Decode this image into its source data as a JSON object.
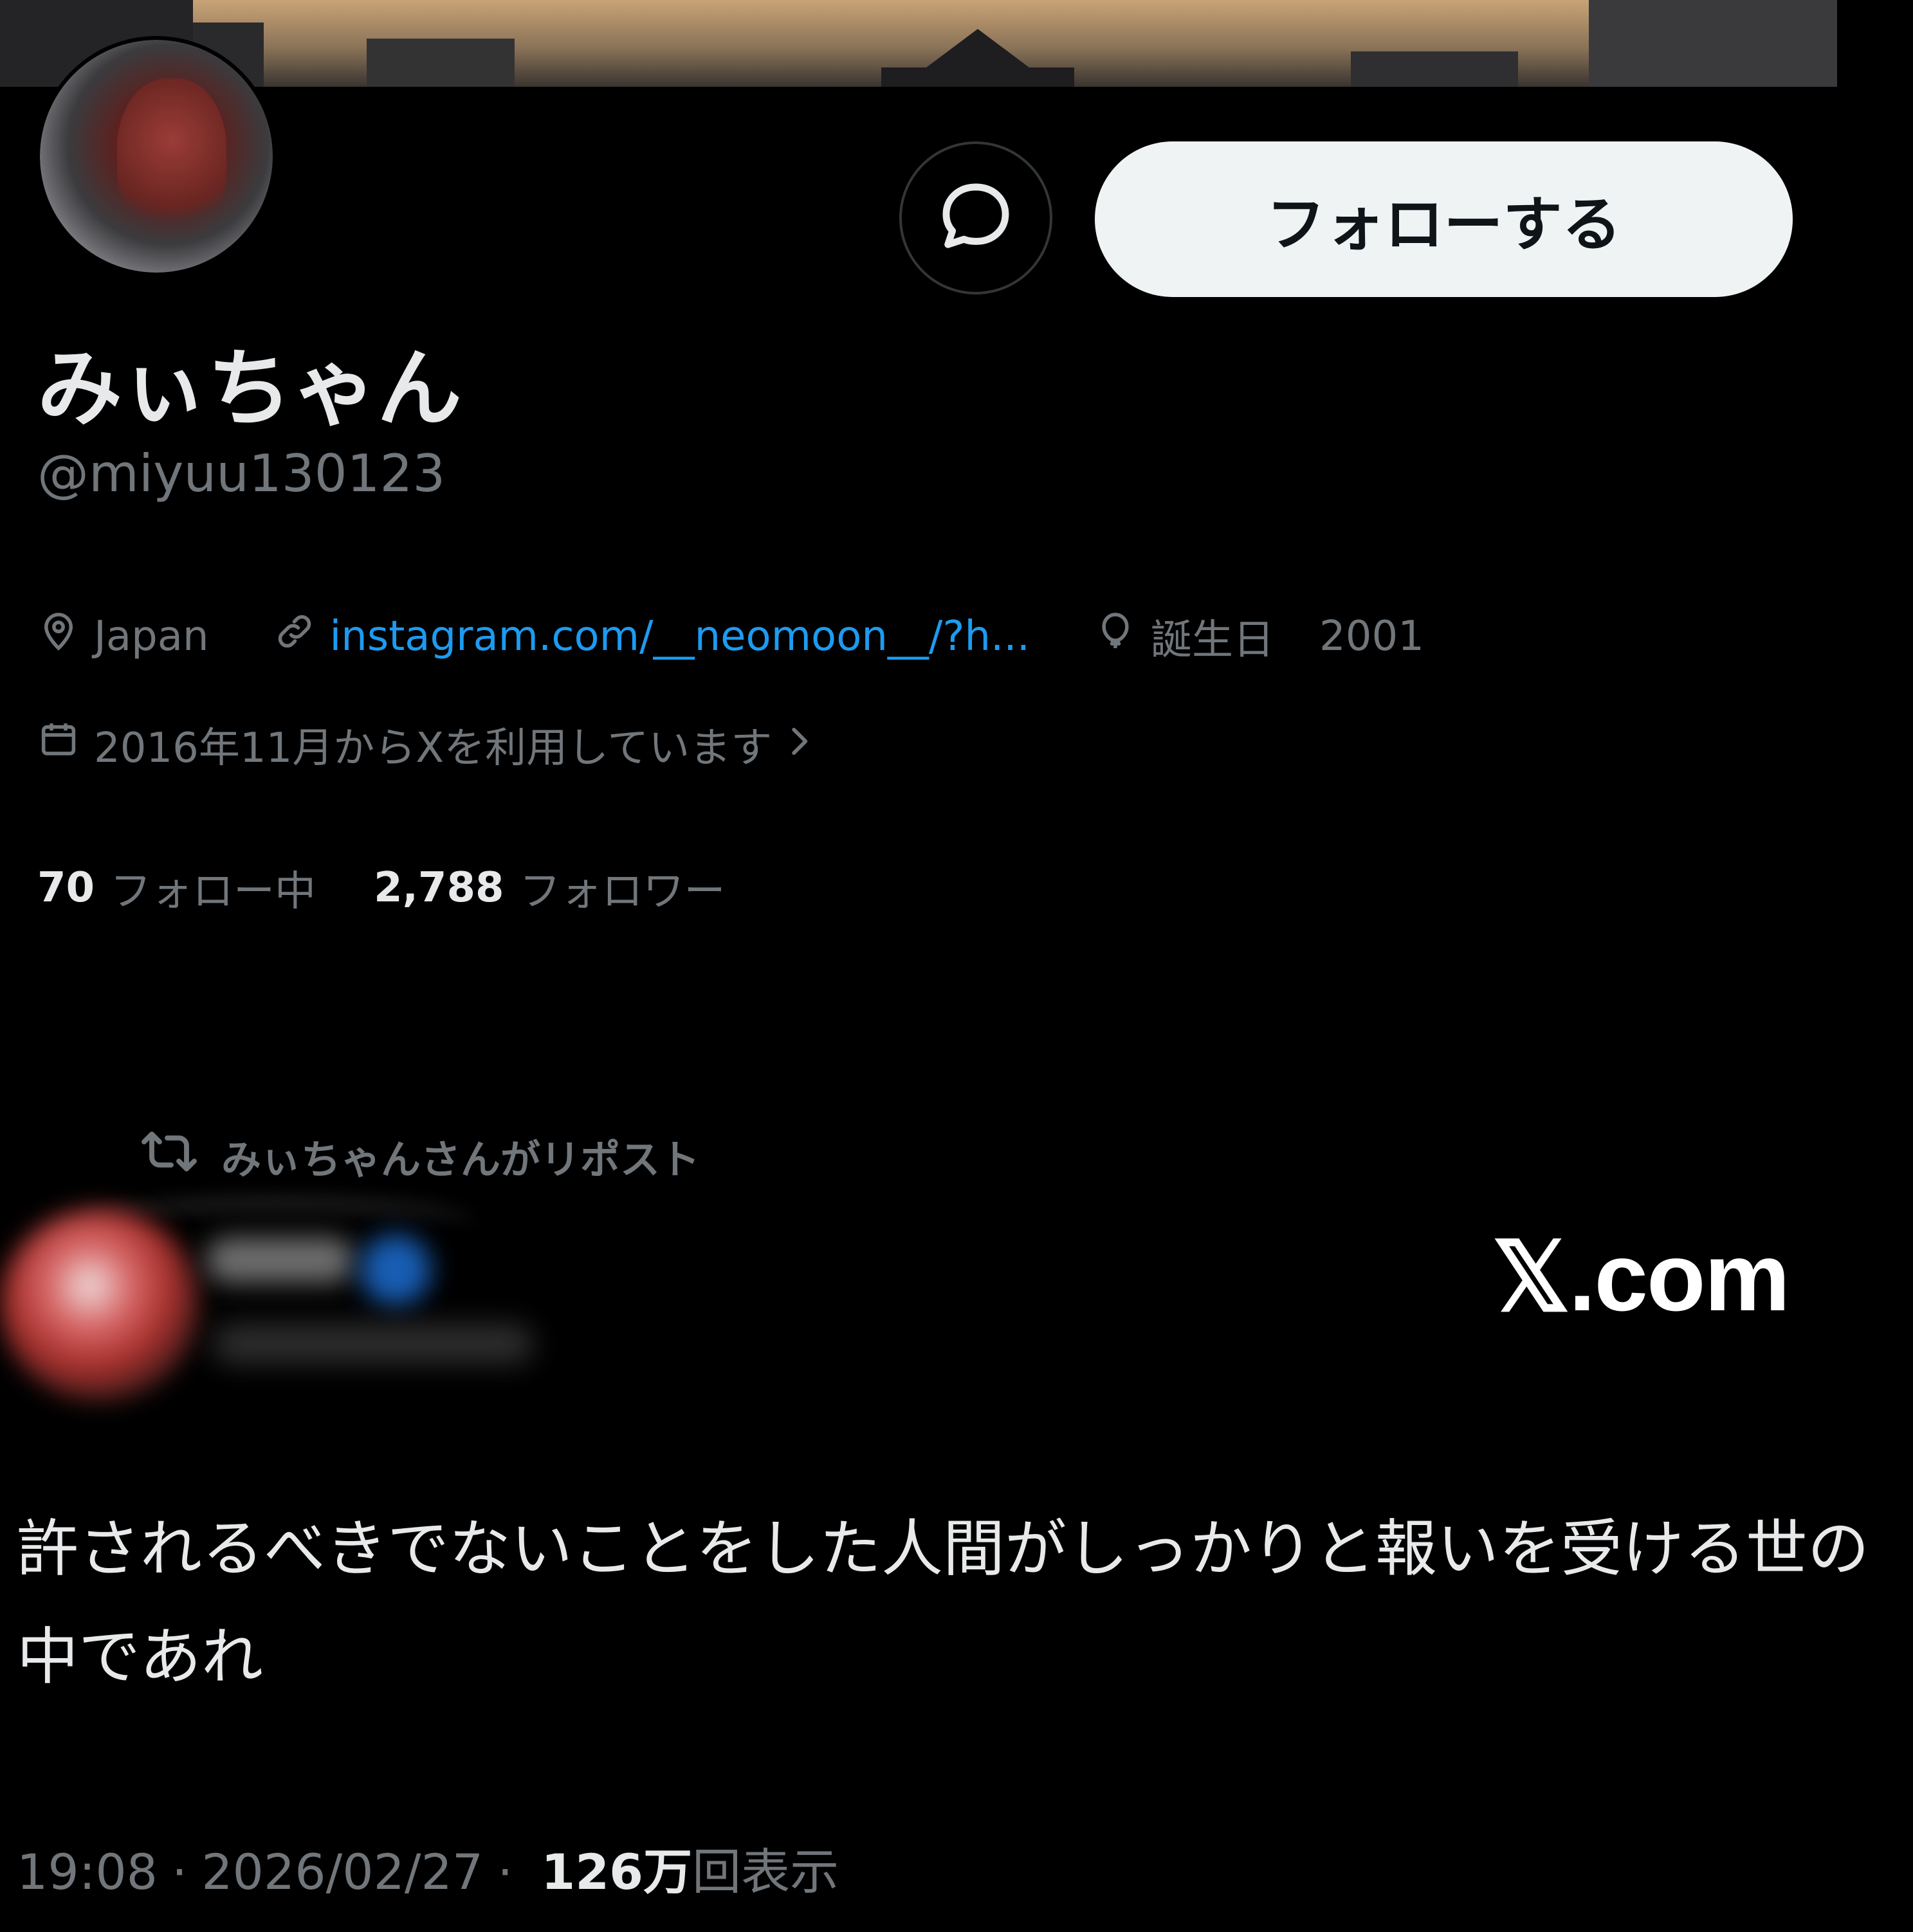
{
  "profile": {
    "display_name": "みぃちゃん",
    "handle": "@miyuu130123",
    "location": "Japan",
    "link": "instagram.com/__neomoon__/?h...",
    "birthday_label": "誕生日",
    "birthday_value": "2001",
    "joined": "2016年11月からXを利用しています"
  },
  "actions": {
    "follow_label": "フォローする"
  },
  "stats": {
    "following_count": "70",
    "following_label": "フォロー中",
    "followers_count": "2,788",
    "followers_label": "フォロワー"
  },
  "post": {
    "repost_label": "みぃちゃんさんがリポスト",
    "text": "許されるべきでないことをした人間がしっかりと報いを受ける世の中であれ",
    "time": "19:08",
    "date": "2026/02/27",
    "separator": "·",
    "views_count": "126万",
    "views_label": "回表示"
  },
  "watermark": "𝕏.com",
  "colors": {
    "background": "#000000",
    "primary_text": "#e7e9ea",
    "secondary_text": "#71767b",
    "link": "#1d9bf0",
    "follow_button_bg": "#eff3f4"
  },
  "icons": [
    "message-icon",
    "location-icon",
    "link-icon",
    "balloon-icon",
    "calendar-icon",
    "chevron-right-icon",
    "repost-icon"
  ]
}
